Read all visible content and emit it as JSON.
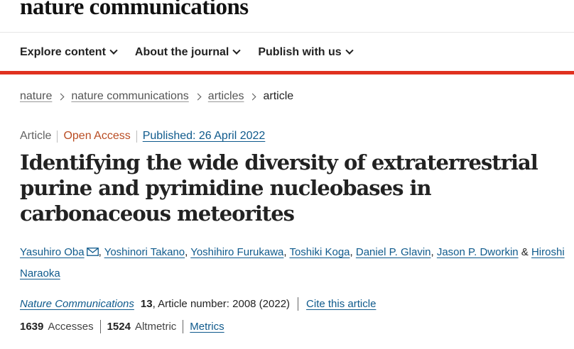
{
  "header": {
    "brand": "nature communications",
    "nav": [
      {
        "label": "Explore content"
      },
      {
        "label": "About the journal"
      },
      {
        "label": "Publish with us"
      }
    ]
  },
  "breadcrumb": {
    "items": [
      "nature",
      "nature communications",
      "articles"
    ],
    "current": "article"
  },
  "article": {
    "type": "Article",
    "access": "Open Access",
    "published": "Published: 26 April 2022",
    "title": "Identifying the wide diversity of extraterrestrial purine and pyrimidine nucleobases in carbonaceous meteorites",
    "authors": [
      "Yasuhiro Oba",
      "Yoshinori Takano",
      "Yoshihiro Furukawa",
      "Toshiki Koga",
      "Daniel P. Glavin",
      "Jason P. Dworkin",
      "Hiroshi Naraoka"
    ],
    "journal": "Nature Communications",
    "volume": "13",
    "article_number": ", Article number: 2008 (2022)",
    "cite_label": "Cite this article",
    "accesses_count": "1639",
    "accesses_label": "Accesses",
    "altmetric_count": "1524",
    "altmetric_label": "Altmetric",
    "metrics_label": "Metrics"
  },
  "colors": {
    "accent_red": "#e0311f",
    "link_blue": "#0f5a8c",
    "open_access": "#b94c22"
  },
  "icons": {
    "corresponding_author": "envelope-icon",
    "nav_dropdown": "chevron-down-icon",
    "breadcrumb_separator": "chevron-right-icon"
  }
}
